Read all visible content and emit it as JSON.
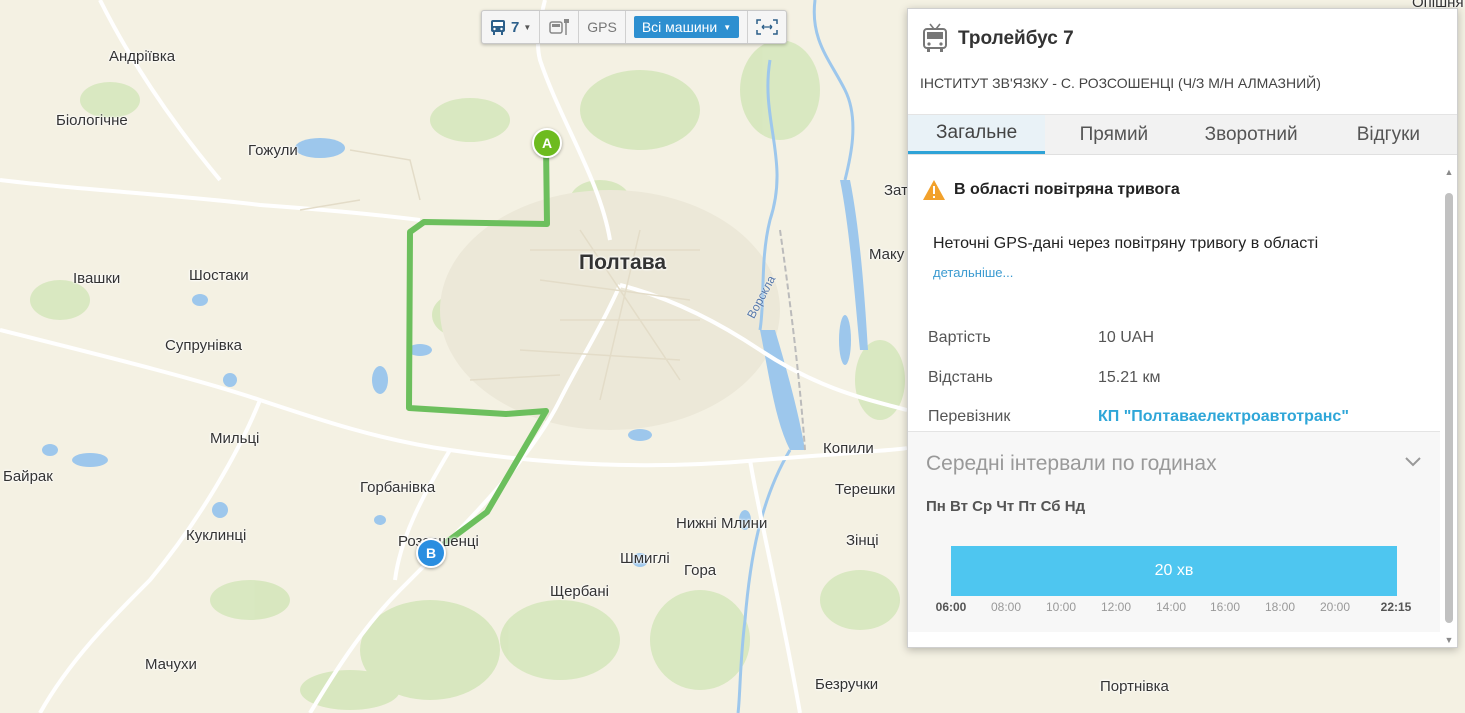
{
  "toolbar": {
    "route_number": "7",
    "gps_label": "GPS",
    "vehicles_select": "Всі машини"
  },
  "map": {
    "city": "Полтава",
    "river": "Ворскла",
    "places": [
      "Андріївка",
      "Біологічне",
      "Гожули",
      "Івашки",
      "Шостаки",
      "Супрунівка",
      "Мильці",
      "Байрак",
      "Горбанівка",
      "Куклинці",
      "Розсошенці",
      "Шмиглі",
      "Нижні Млини",
      "Гора",
      "Щербані",
      "Мачухи",
      "Безручки",
      "Портнівка",
      "Копили",
      "Терешки",
      "Зінці",
      "Затурине",
      "Маку",
      "Опішня"
    ],
    "marker_a": "A",
    "marker_b": "B"
  },
  "panel": {
    "title": "Тролейбус 7",
    "subtitle": "ІНСТИТУТ ЗВ'ЯЗКУ - С. РОЗСОШЕНЦІ (Ч/З М/Н АЛМАЗНИЙ)",
    "tabs": [
      "Загальне",
      "Прямий",
      "Зворотний",
      "Відгуки"
    ],
    "alert": {
      "title": "В області повітряна тривога",
      "text": "Неточні GPS-дані через повітряну тривогу в області",
      "more": "детальніше..."
    },
    "info": {
      "price_label": "Вартість",
      "price": "10 UAH",
      "distance_label": "Відстань",
      "distance": "15.21 км",
      "carrier_label": "Перевізник",
      "carrier": "КП \"Полтаваелектроавтотранс\""
    },
    "intervals": {
      "title": "Середні інтервали по годинах",
      "days": "Пн Вт Ср Чт Пт Сб Нд",
      "interval": "20 хв",
      "start": "06:00",
      "end": "22:15",
      "ticks": [
        "08:00",
        "10:00",
        "12:00",
        "14:00",
        "16:00",
        "18:00",
        "20:00"
      ]
    }
  },
  "colors": {
    "route": "#6cbf5d",
    "accent": "#2fa3d7",
    "bar": "#4ec6f0",
    "marker_a": "#6dbb1f",
    "marker_b": "#2a8ee0"
  }
}
